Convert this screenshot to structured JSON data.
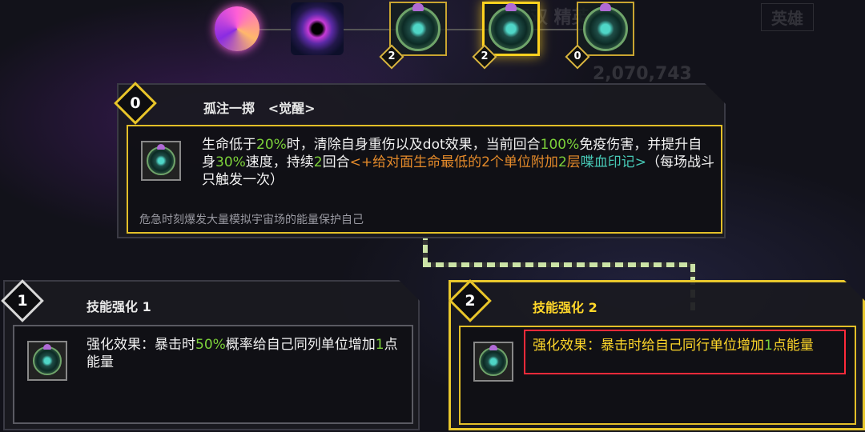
{
  "background_hints": {
    "title_fragment": "无双 精英",
    "button_text": "英雄",
    "power_value": "2,070,743"
  },
  "skill_bar": [
    {
      "icon": "swirl-orb-icon",
      "level": null
    },
    {
      "icon": "galaxy-vortex-icon",
      "level": null
    },
    {
      "icon": "star-shield-orb-icon",
      "level": "2"
    },
    {
      "icon": "lightning-shield-orb-icon",
      "level": "2",
      "selected": true
    },
    {
      "icon": "arrow-shield-orb-icon",
      "level": "0"
    }
  ],
  "main_skill": {
    "level": "0",
    "name": "孤注一掷",
    "tag": "<觉醒>",
    "description": {
      "p1": "生命低于",
      "v1": "20%",
      "p2": "时，清除自身重伤以及dot效果，当前回合",
      "v2": "100%",
      "p3": "免疫伤害，并提升自身",
      "v3": "30%",
      "p4": "速度，持续",
      "v4": "2",
      "p5": "回合",
      "o1": "<+给对面生命最低的2个单位附加",
      "v5": "2",
      "o2": "层",
      "t1": "喋血印记>",
      "p6": "（每场战斗只触发一次）"
    },
    "flavor": "危急时刻爆发大量模拟宇宙场的能量保护自己"
  },
  "upgrade_1": {
    "level": "1",
    "title": "技能强化 1",
    "p1": "强化效果：暴击时",
    "v1": "50%",
    "p2": "概率给自己同列单位增加",
    "v2": "1",
    "p3": "点能量"
  },
  "upgrade_2": {
    "level": "2",
    "title": "技能强化 2",
    "p1": "强化效果：暴击时给自己同行单位增加",
    "v1": "1",
    "p2": "点能量"
  },
  "colors": {
    "gold": "#e8c72d",
    "value_green": "#7cd13a",
    "effect_orange": "#e48a2a",
    "mark_teal": "#47c9b6",
    "highlight_red": "#ff2a3a"
  }
}
